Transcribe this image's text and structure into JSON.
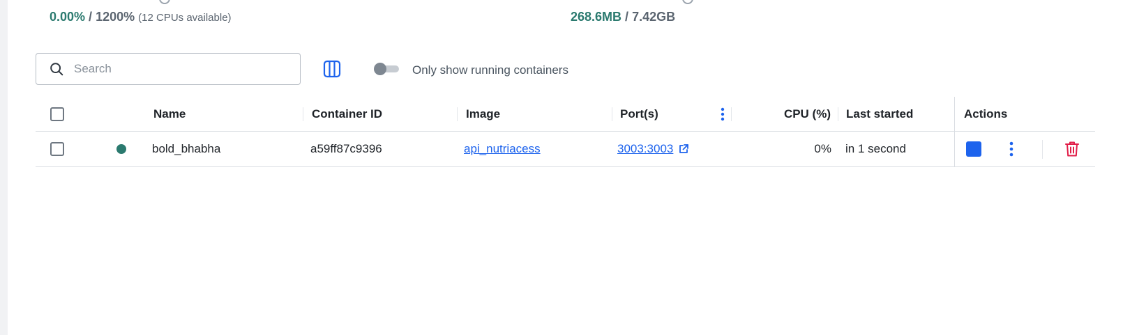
{
  "stats": {
    "cpu_usage": "0.00%",
    "cpu_sep": " / ",
    "cpu_total": "1200%",
    "cpu_note": "(12 CPUs available)",
    "mem_usage": "268.6MB",
    "mem_sep": " / ",
    "mem_total": "7.42GB"
  },
  "toolbar": {
    "search_placeholder": "Search",
    "search_value": "",
    "columns_icon": "columns-icon",
    "toggle_label": "Only show running containers",
    "toggle_on": false
  },
  "table": {
    "headers": {
      "name": "Name",
      "container_id": "Container ID",
      "image": "Image",
      "ports": "Port(s)",
      "cpu": "CPU (%)",
      "last_started": "Last started",
      "actions": "Actions"
    },
    "rows": [
      {
        "status": "running",
        "status_color": "#2b7a6f",
        "name": "bold_bhabha",
        "container_id": "a59ff87c9396",
        "image": "api_nutriacess",
        "ports": "3003:3003",
        "cpu": "0%",
        "last_started": "in 1 second"
      }
    ]
  },
  "colors": {
    "accent": "#1d63ed",
    "green": "#2b7a6f",
    "danger": "#e11d48"
  }
}
